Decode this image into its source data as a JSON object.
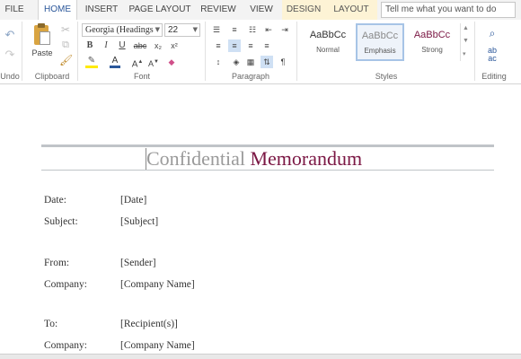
{
  "ribbon_tabs": [
    "FILE",
    "HOME",
    "INSERT",
    "PAGE LAYOUT",
    "REVIEW",
    "VIEW",
    "DESIGN",
    "LAYOUT"
  ],
  "tell_me": "Tell me what you want to do",
  "groups": {
    "undo": "Undo",
    "clipboard": "Clipboard",
    "font": "Font",
    "paragraph": "Paragraph",
    "styles": "Styles",
    "editing": "Editing"
  },
  "clipboard": {
    "paste": "Paste"
  },
  "font": {
    "family": "Georgia (Headings",
    "size": "22"
  },
  "styles": [
    {
      "preview": "AaBbCc",
      "name": "Normal",
      "color": "#333333"
    },
    {
      "preview": "AaBbCc",
      "name": "Emphasis",
      "color": "#8a8a8a"
    },
    {
      "preview": "AaBbCc",
      "name": "Strong",
      "color": "#7b1744"
    }
  ],
  "document": {
    "title_part1": "Confidential",
    "title_part2": "Memorandum",
    "fields": [
      {
        "label": "Date:",
        "value": "[Date]"
      },
      {
        "label": "Subject:",
        "value": "[Subject]"
      },
      {
        "label": "From:",
        "value": "[Sender]"
      },
      {
        "label": "Company:",
        "value": "[Company Name]"
      },
      {
        "label": "To:",
        "value": "[Recipient(s)]"
      },
      {
        "label": "Company:",
        "value": "[Company Name]"
      }
    ]
  },
  "colors": {
    "accent": "#2b579a",
    "title_accent": "#7b1744"
  }
}
